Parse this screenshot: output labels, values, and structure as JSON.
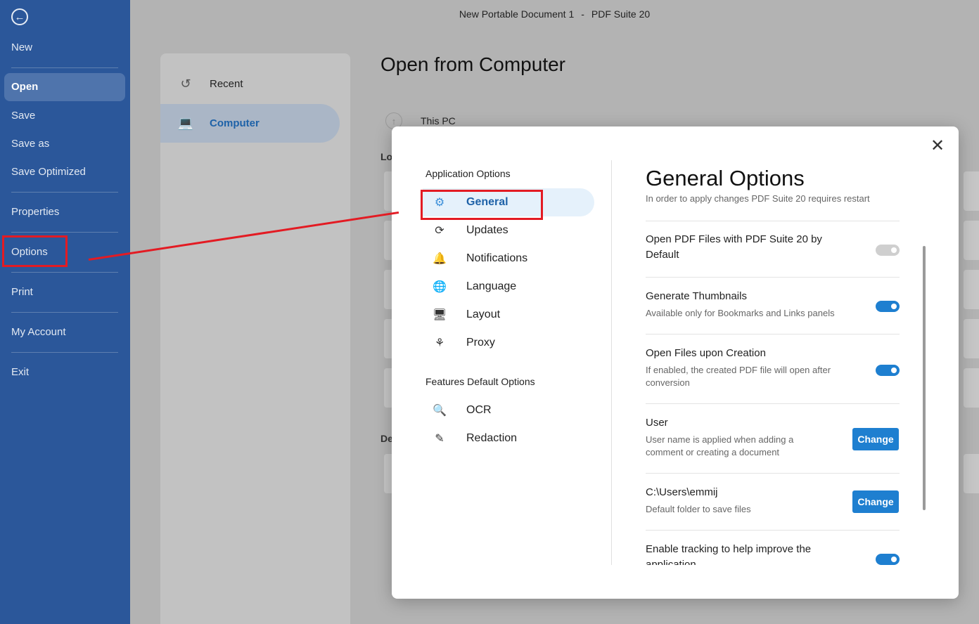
{
  "window": {
    "document": "New Portable Document 1",
    "separator": "-",
    "app": "PDF Suite 20"
  },
  "sidebar": {
    "items": [
      "New",
      "Open",
      "Save",
      "Save as",
      "Save Optimized",
      "Properties",
      "Options",
      "Print",
      "My Account",
      "Exit"
    ]
  },
  "locations": {
    "items": [
      "Recent",
      "Computer"
    ]
  },
  "main": {
    "title": "Open from Computer",
    "this_pc": "This PC",
    "section_cut_1": "Lo",
    "section_cut_2": "De"
  },
  "dialog": {
    "groups": [
      "Application Options",
      "Features Default Options"
    ],
    "app_items": [
      "General",
      "Updates",
      "Notifications",
      "Language",
      "Layout",
      "Proxy"
    ],
    "feature_items": [
      "OCR",
      "Redaction"
    ],
    "title": "General Options",
    "subtitle": "In order to apply changes PDF Suite 20 requires restart",
    "settings": [
      {
        "title": "Open PDF Files with PDF Suite 20 by Default",
        "desc": "",
        "control": "toggle-off"
      },
      {
        "title": "Generate Thumbnails",
        "desc": "Available only for Bookmarks and Links panels",
        "control": "toggle-on"
      },
      {
        "title": "Open Files upon Creation",
        "desc": "If enabled, the created PDF file will open after conversion",
        "control": "toggle-on"
      },
      {
        "title": "User",
        "desc": "User name is applied when adding a comment or creating a document",
        "control": "button"
      },
      {
        "title": "C:\\Users\\emmij",
        "desc": "Default folder to save files",
        "control": "button"
      },
      {
        "title": "Enable tracking to help improve the application",
        "desc": "",
        "control": "toggle-on"
      }
    ],
    "change_label": "Change"
  },
  "colors": {
    "sidebar": "#2b579a",
    "accent": "#1e7fd0",
    "annotation": "#e31b23"
  }
}
